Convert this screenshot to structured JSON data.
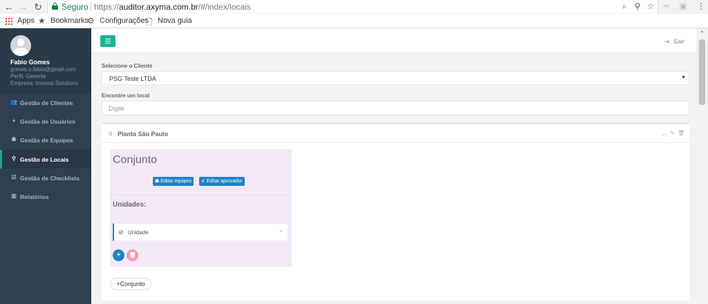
{
  "browser": {
    "secure_label": "Seguro",
    "url_scheme": "https://",
    "url_host": "auditor.axyma.com.br",
    "url_path": "/#/index/locais",
    "bookmarks": [
      {
        "label": "Apps",
        "icon": "apps-grid-icon"
      },
      {
        "label": "Bookmarks",
        "icon": "star-icon"
      },
      {
        "label": "Configurações",
        "icon": "gear-icon"
      },
      {
        "label": "Nova guia",
        "icon": "page-icon"
      }
    ]
  },
  "profile": {
    "name": "Fabio Gomes",
    "email": "gomes.s.fabio@gmail.com",
    "role": "Perfil: Gerente",
    "company": "Empresa: Innovat Solutions"
  },
  "sidebar": {
    "items": [
      {
        "label": "Gestão de Clientes",
        "icon": "users-icon",
        "active": false
      },
      {
        "label": "Gestão de Usuários",
        "icon": "user-icon",
        "active": false
      },
      {
        "label": "Gestão de Equipes",
        "icon": "team-icon",
        "active": false
      },
      {
        "label": "Gestão de Locais",
        "icon": "map-marker-icon",
        "active": true
      },
      {
        "label": "Gestão de Checklists",
        "icon": "checklist-icon",
        "active": false
      },
      {
        "label": "Relatórios",
        "icon": "bar-chart-icon",
        "active": false
      }
    ]
  },
  "topbar": {
    "logout_label": "Sair"
  },
  "form": {
    "client_label": "Selecione o Cliente",
    "client_value": "PSG Teste LTDA",
    "search_label": "Encontre um local",
    "search_placeholder": "Digite"
  },
  "location": {
    "title": "Planta São Paulo",
    "set": {
      "title": "Conjunto",
      "edit_teams_label": "Editar equipes",
      "edit_approver_label": "Editar aprovador",
      "units_label": "Unidades:",
      "units": [
        {
          "label": "Unidade"
        }
      ]
    },
    "add_set_label": "Conjunto"
  },
  "colors": {
    "sidebar_bg": "#2f4050",
    "accent_green": "#1ab394",
    "primary_blue": "#1c84c6",
    "danger_pink": "#f09aac",
    "card_bg": "#f3e9f6"
  }
}
